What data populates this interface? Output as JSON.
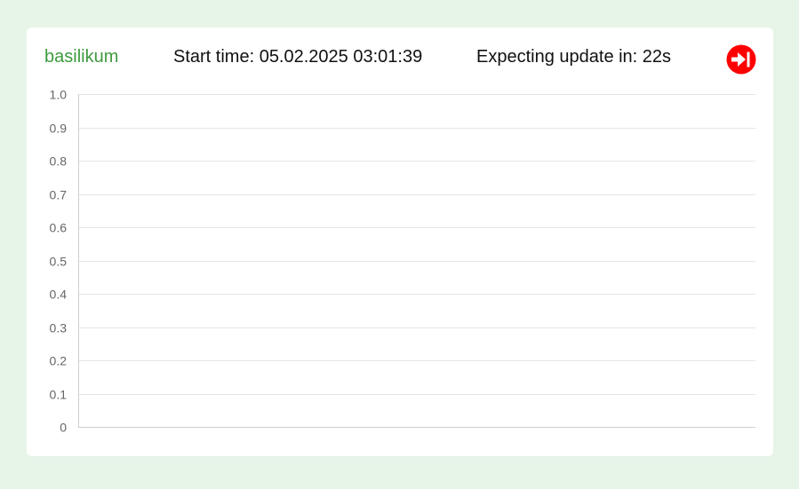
{
  "header": {
    "plant_name": "basilikum",
    "start_time": "Start time: 05.02.2025 03:01:39",
    "update_text": "Expecting update in: 22s"
  },
  "actions": {
    "skip_icon": "skip-forward-icon",
    "skip_color": "#ff0000"
  },
  "colors": {
    "background": "#e7f5e8",
    "card": "#ffffff",
    "plant_name": "#3e9a3e",
    "grid": "#e5e5e5",
    "axis": "#cfcfcf"
  },
  "chart_data": {
    "type": "line",
    "title": "",
    "xlabel": "",
    "ylabel": "",
    "x": [],
    "series": [],
    "ylim": [
      0,
      1
    ],
    "yticks": [
      "0",
      "0.1",
      "0.2",
      "0.3",
      "0.4",
      "0.5",
      "0.6",
      "0.7",
      "0.8",
      "0.9",
      "1.0"
    ],
    "grid": true
  }
}
